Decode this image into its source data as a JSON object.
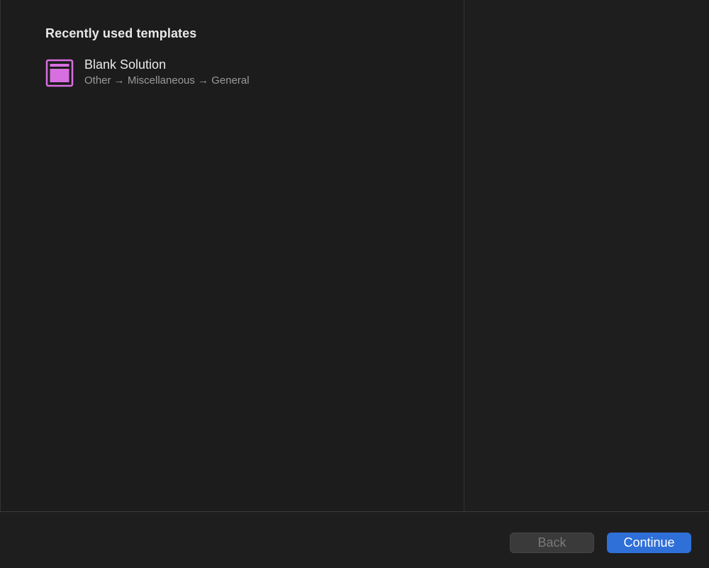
{
  "section": {
    "title": "Recently used templates"
  },
  "templates": [
    {
      "name": "Blank Solution",
      "path": "Other → Miscellaneous → General",
      "icon": "window-template-icon"
    }
  ],
  "footer": {
    "back_label": "Back",
    "continue_label": "Continue"
  },
  "colors": {
    "accent": "#2f6fd8",
    "icon": "#d86fe0",
    "background": "#1e1e1e"
  }
}
